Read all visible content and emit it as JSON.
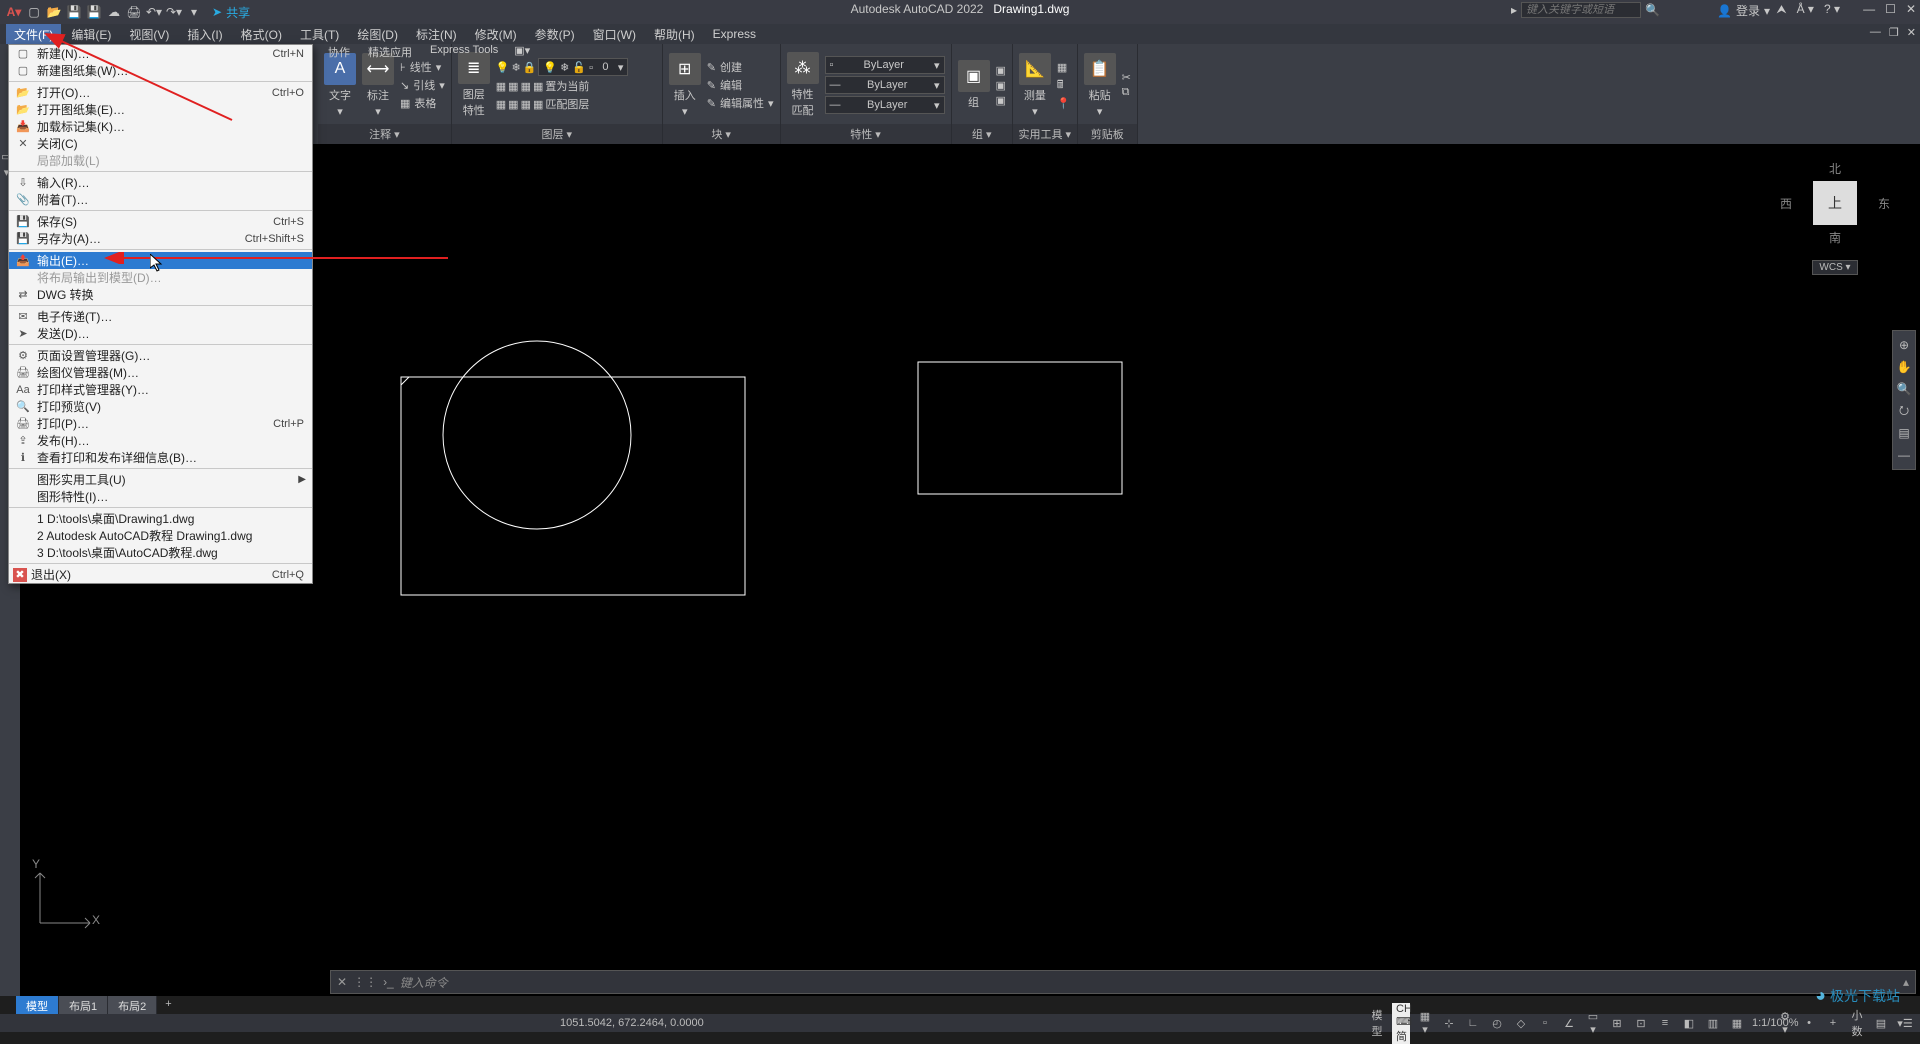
{
  "title": {
    "app": "Autodesk AutoCAD 2022",
    "file": "Drawing1.dwg"
  },
  "qa": {
    "share": "共享"
  },
  "search": {
    "placeholder": "键入关键字或短语"
  },
  "signin": {
    "label": "登录"
  },
  "menubar": [
    "文件(F)",
    "编辑(E)",
    "视图(V)",
    "插入(I)",
    "格式(O)",
    "工具(T)",
    "绘图(D)",
    "标注(N)",
    "修改(M)",
    "参数(P)",
    "窗口(W)",
    "帮助(H)",
    "Express"
  ],
  "file_menu": {
    "items": [
      {
        "ico": "▢",
        "label": "新建(N)…",
        "sc": "Ctrl+N"
      },
      {
        "ico": "▢",
        "label": "新建图纸集(W)…"
      },
      {
        "sep": true
      },
      {
        "ico": "📂",
        "label": "打开(O)…",
        "sc": "Ctrl+O"
      },
      {
        "ico": "📂",
        "label": "打开图纸集(E)…"
      },
      {
        "ico": "📥",
        "label": "加载标记集(K)…"
      },
      {
        "ico": "✕",
        "label": "关闭(C)"
      },
      {
        "ico": "",
        "label": "局部加载(L)",
        "dis": true
      },
      {
        "sep": true
      },
      {
        "ico": "⇩",
        "label": "输入(R)…"
      },
      {
        "ico": "📎",
        "label": "附着(T)…"
      },
      {
        "sep": true
      },
      {
        "ico": "💾",
        "label": "保存(S)",
        "sc": "Ctrl+S"
      },
      {
        "ico": "💾",
        "label": "另存为(A)…",
        "sc": "Ctrl+Shift+S"
      },
      {
        "sep": true
      },
      {
        "ico": "📤",
        "label": "输出(E)…",
        "hl": true
      },
      {
        "ico": "",
        "label": "将布局输出到模型(D)…",
        "dis": true
      },
      {
        "ico": "⇄",
        "label": "DWG 转换"
      },
      {
        "sep": true
      },
      {
        "ico": "✉",
        "label": "电子传递(T)…"
      },
      {
        "ico": "➤",
        "label": "发送(D)…"
      },
      {
        "sep": true
      },
      {
        "ico": "⚙",
        "label": "页面设置管理器(G)…"
      },
      {
        "ico": "🖨",
        "label": "绘图仪管理器(M)…"
      },
      {
        "ico": "Aa",
        "label": "打印样式管理器(Y)…"
      },
      {
        "ico": "🔍",
        "label": "打印预览(V)"
      },
      {
        "ico": "🖨",
        "label": "打印(P)…",
        "sc": "Ctrl+P"
      },
      {
        "ico": "⇪",
        "label": "发布(H)…"
      },
      {
        "ico": "ℹ",
        "label": "查看打印和发布详细信息(B)…"
      },
      {
        "sep": true
      },
      {
        "ico": "",
        "label": "图形实用工具(U)",
        "arr": true
      },
      {
        "ico": "",
        "label": "图形特性(I)…"
      },
      {
        "sep": true
      },
      {
        "ico": "",
        "label": "1 D:\\tools\\桌面\\Drawing1.dwg"
      },
      {
        "ico": "",
        "label": "2 Autodesk AutoCAD教程 Drawing1.dwg"
      },
      {
        "ico": "",
        "label": "3 D:\\tools\\桌面\\AutoCAD教程.dwg"
      },
      {
        "sep": true
      },
      {
        "ico": "✖",
        "label": "退出(X)",
        "sc": "Ctrl+Q",
        "red": true
      }
    ]
  },
  "ribbon_tabs_right": [
    "协作",
    "精选应用",
    "Express Tools"
  ],
  "ribbon": {
    "annotate": {
      "title": "注释 ▾",
      "text": "文字",
      "dim": "标注",
      "linetype": "线性",
      "leader": "引线",
      "table": "表格"
    },
    "layers": {
      "title": "图层 ▾",
      "btn": "图层\n特性",
      "set_current": "置为当前",
      "match": "匹配图层",
      "zero": "0"
    },
    "blocks": {
      "title": "块 ▾",
      "insert": "插入",
      "create": "创建",
      "edit": "编辑",
      "attr": "编辑属性"
    },
    "props": {
      "title": "特性 ▾",
      "match": "特性\n匹配",
      "bylayer": "ByLayer"
    },
    "groups": {
      "title": "组 ▾",
      "grp": "组"
    },
    "utils": {
      "title": "实用工具 ▾",
      "measure": "测量"
    },
    "clip": {
      "title": "剪贴板",
      "paste": "粘贴"
    }
  },
  "viewcube": {
    "n": "北",
    "s": "南",
    "e": "东",
    "w": "西",
    "top": "上",
    "wcs": "WCS"
  },
  "cmd": {
    "prompt": "键入命令",
    "x": "✕",
    "chev": "›_"
  },
  "bottom_tabs": {
    "model": "模型",
    "l1": "布局1",
    "l2": "布局2"
  },
  "status": {
    "coords": "1051.5042, 672.2464, 0.0000",
    "space": "模型",
    "ime": "CH ⌨ 简",
    "scale": "1:1/100%",
    "decimal": "小数"
  },
  "watermark": "极光下载站",
  "ucs": {
    "x": "X",
    "y": "Y"
  }
}
